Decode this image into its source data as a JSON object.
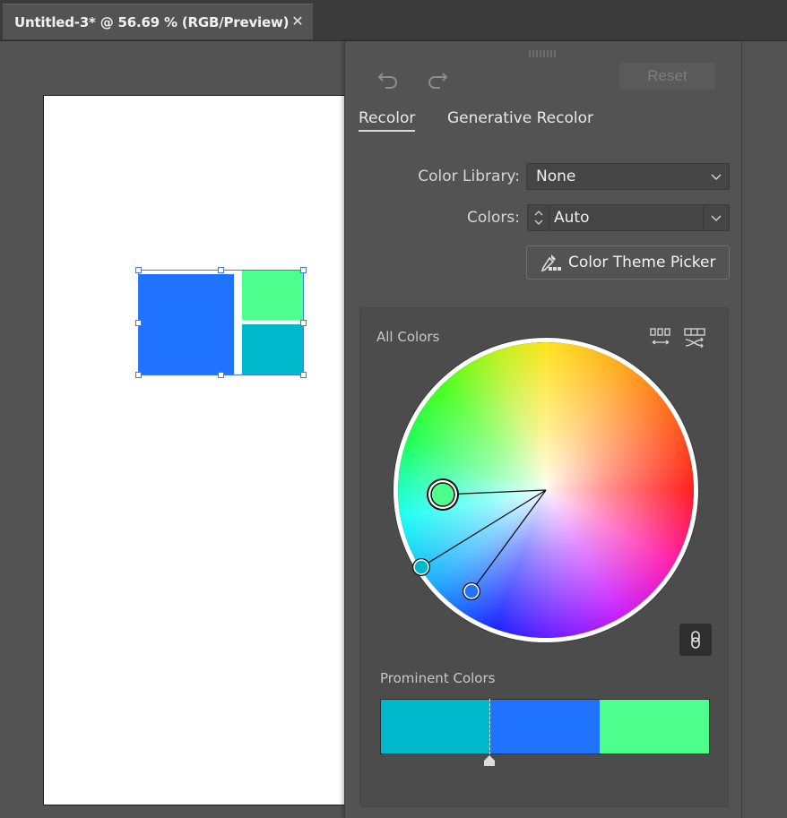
{
  "document_tab": {
    "title": "Untitled-3* @ 56.69 % (RGB/Preview)",
    "close_glyph": "✕"
  },
  "artwork": {
    "shapes": [
      {
        "name": "large-square",
        "color": "#2073ff"
      },
      {
        "name": "top-right-rect",
        "color": "#4dff8c"
      },
      {
        "name": "bottom-right-rect",
        "color": "#00b8cc"
      }
    ]
  },
  "panel": {
    "toolbar": {
      "undo_icon": "undo-icon",
      "redo_icon": "redo-icon",
      "reset_label": "Reset"
    },
    "tabs": [
      {
        "label": "Recolor",
        "active": true
      },
      {
        "label": "Generative Recolor",
        "active": false
      }
    ],
    "color_library": {
      "label": "Color Library:",
      "value": "None"
    },
    "colors": {
      "label": "Colors:",
      "value": "Auto"
    },
    "theme_picker": {
      "label": "Color Theme Picker",
      "icon": "eyedropper-icon"
    },
    "all_colors": {
      "label": "All Colors",
      "icons": [
        "distribute-harmony-icon",
        "randomize-icon"
      ],
      "wheel_colors": [
        "#4dff8c",
        "#00b8cc",
        "#2073ff"
      ],
      "link_icon": "link-icon"
    },
    "prominent_colors": {
      "label": "Prominent Colors",
      "swatches": [
        "#00b8cc",
        "#2073ff",
        "#4dff8c"
      ]
    }
  },
  "colors": {
    "background": "#535353",
    "panel": "#535353",
    "selection": "#3b7bff"
  }
}
